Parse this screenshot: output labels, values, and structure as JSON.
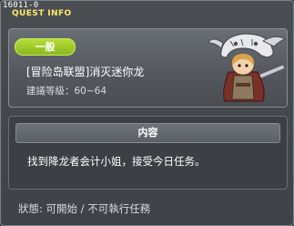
{
  "window": {
    "quest_id": "16011-0",
    "title": "QUEST INFO"
  },
  "quest": {
    "category_badge": "一般",
    "name": "[冒险岛联盟]消灭迷你龙",
    "recommended_level": "建議等級：60~64"
  },
  "npc": {
    "icon": "dragon-skull-knight-npc"
  },
  "content": {
    "header": "内容",
    "text": "找到降龙者会计小姐，接受今日任务。"
  },
  "status": {
    "text": "狀態: 可開始 / 不可執行任務"
  },
  "colors": {
    "title": "#ffe86a",
    "badge": "#9fcb2a",
    "panel": "#55595f"
  }
}
